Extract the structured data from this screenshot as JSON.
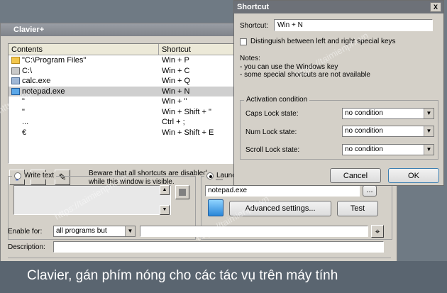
{
  "main_window": {
    "title": "Clavier+",
    "columns": [
      "Contents",
      "Shortcut"
    ],
    "rows": [
      {
        "content": "\"C:\\Program Files\"",
        "shortcut": "Win + P",
        "icon": "folder-icon"
      },
      {
        "content": "C:\\",
        "shortcut": "Win + C",
        "icon": "drive-icon"
      },
      {
        "content": "calc.exe",
        "shortcut": "Win + Q",
        "icon": "calculator-icon"
      },
      {
        "content": "notepad.exe",
        "shortcut": "Win + N",
        "icon": "notepad-icon",
        "selected": true
      },
      {
        "content": "\"",
        "shortcut": "Win + \"",
        "icon": ""
      },
      {
        "content": "\"",
        "shortcut": "Win + Shift + \"",
        "icon": ""
      },
      {
        "content": "...",
        "shortcut": "Ctrl + ;",
        "icon": ""
      },
      {
        "content": "€",
        "shortcut": "Win + Shift + E",
        "icon": ""
      }
    ],
    "warning": "Beware that all shortcuts are disabled while this window is visible.",
    "checkbox_partial": "La",
    "write_text_label": "Write text",
    "launch_label": "Launc",
    "launch_value": "notepad.exe",
    "launch_browse": "...",
    "advanced_settings": "Advanced settings...",
    "test": "Test",
    "enable_for_label": "Enable for:",
    "enable_for_value": "all programs but",
    "description_label": "Description:"
  },
  "dialog": {
    "title": "Shortcut",
    "shortcut_label": "Shortcut:",
    "shortcut_value": "Win + N",
    "distinguish_label": "Distinguish between left and right special keys",
    "notes_title": "Notes:",
    "note1": "- you can use the Windows key",
    "note2": "- some special shortcuts are not available",
    "group_title": "Activation condition",
    "caps_label": "Caps Lock state:",
    "num_label": "Num Lock state:",
    "scroll_label": "Scroll Lock state:",
    "caps_value": "no condition",
    "num_value": "no condition",
    "scroll_value": "no condition",
    "cancel": "Cancel",
    "ok": "OK",
    "close": "X"
  },
  "watermark": "https://taimienphi.vn",
  "caption": "Clavier, gán phím nóng cho các tác vụ trên máy tính",
  "colors": {
    "caption_bg": "#5a6570",
    "title_active": "#6d7178",
    "add_icon": "#1a4fd0",
    "delete_icon": "#d11b1b"
  }
}
